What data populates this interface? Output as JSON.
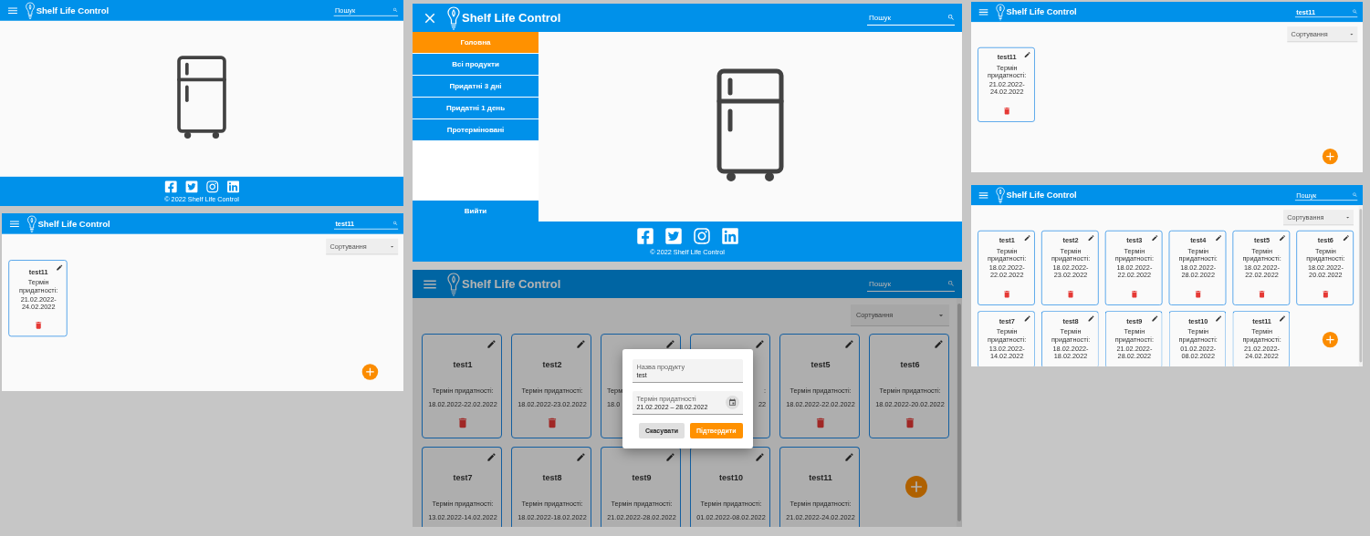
{
  "screens": [
    {
      "kind": "home",
      "header": {
        "menu_open": false,
        "title": "Shelf Life Control",
        "search": {
          "placeholder": "Пошук"
        }
      },
      "footer": {
        "copyright": "© 2022 Shelf Life Control"
      }
    },
    {
      "kind": "list",
      "header": {
        "menu_open": false,
        "title": "Shelf Life Control",
        "search": {
          "value": "test11"
        }
      },
      "sort": {
        "placeholder": "Сортування"
      },
      "scrollbar": false,
      "cards": [
        {
          "kind": "full",
          "title": "test11",
          "label": "Термін придатності:",
          "dates": "21.02.2022-24.02.2022"
        }
      ]
    },
    {
      "kind": "menu",
      "header": {
        "menu_open": true,
        "title": "Shelf Life Control",
        "search": {
          "placeholder": "Пошук"
        }
      },
      "sidebar": {
        "items": [
          {
            "label": "Головна",
            "selected": true
          },
          {
            "label": "Всі продукти",
            "selected": false
          },
          {
            "label": "Придатні 3 дні",
            "selected": false
          },
          {
            "label": "Придатні 1 день",
            "selected": false
          },
          {
            "label": "Протерміновані",
            "selected": false
          }
        ],
        "logout": "Вийти"
      },
      "footer": {
        "copyright": "© 2022 Shelf Life Control"
      }
    },
    {
      "kind": "list",
      "header": {
        "menu_open": false,
        "title": "Shelf Life Control",
        "search": {
          "placeholder": "Пошук"
        }
      },
      "sort": {
        "placeholder": "Сортування"
      },
      "scrollbar": true,
      "cards": [
        {
          "kind": "full",
          "title": "test1",
          "label": "Термін придатності:",
          "dates": "18.02.2022-22.02.2022"
        },
        {
          "kind": "full",
          "title": "test2",
          "label": "Термін придатності:",
          "dates": "18.02.2022-23.02.2022"
        },
        {
          "kind": "clip_left",
          "label": "Терм",
          "dates": "18.0"
        },
        {
          "kind": "clip_right",
          "label": ":",
          "dates": "22"
        },
        {
          "kind": "full",
          "title": "test5",
          "label": "Термін придатності:",
          "dates": "18.02.2022-22.02.2022"
        },
        {
          "kind": "full",
          "title": "test6",
          "label": "Термін придатності:",
          "dates": "18.02.2022-20.02.2022"
        },
        {
          "kind": "cut",
          "title": "test7",
          "label": "Термін придатності:",
          "dates": "13.02.2022-14.02.2022"
        },
        {
          "kind": "cut",
          "title": "test8",
          "label": "Термін придатності:",
          "dates": "18.02.2022-18.02.2022"
        },
        {
          "kind": "cut",
          "title": "test9",
          "label": "Термін придатності:",
          "dates": "21.02.2022-28.02.2022"
        },
        {
          "kind": "cut",
          "title": "test10",
          "label": "Термін придатності:",
          "dates": "01.02.2022-08.02.2022"
        },
        {
          "kind": "cut",
          "title": "test11",
          "label": "Термін придатності:",
          "dates": "21.02.2022-24.02.2022"
        }
      ],
      "dialog": {
        "fields": [
          {
            "kind": "text",
            "label": "Назва продукту",
            "value": "test"
          },
          {
            "kind": "date",
            "label": "Термін придатності",
            "value": "21.02.2022 – 28.02.2022"
          }
        ],
        "buttons": [
          {
            "kind": "secondary",
            "label": "Скасувати"
          },
          {
            "kind": "primary",
            "label": "Підтвердити"
          }
        ]
      }
    },
    {
      "kind": "list",
      "header": {
        "menu_open": false,
        "title": "Shelf Life Control",
        "search": {
          "value": "test11"
        }
      },
      "sort": {
        "placeholder": "Сортування"
      },
      "scrollbar": false,
      "cards": [
        {
          "kind": "full",
          "title": "test11",
          "label": "Термін придатності:",
          "dates": "21.02.2022-24.02.2022"
        }
      ]
    },
    {
      "kind": "list",
      "header": {
        "menu_open": false,
        "title": "Shelf Life Control",
        "search": {
          "placeholder": "Пошук"
        }
      },
      "sort": {
        "placeholder": "Сортування"
      },
      "scrollbar": true,
      "cards": [
        {
          "kind": "full",
          "title": "test1",
          "label": "Термін придатності:",
          "dates": "18.02.2022-22.02.2022"
        },
        {
          "kind": "full",
          "title": "test2",
          "label": "Термін придатності:",
          "dates": "18.02.2022-23.02.2022"
        },
        {
          "kind": "full",
          "title": "test3",
          "label": "Термін придатності:",
          "dates": "18.02.2022-22.02.2022"
        },
        {
          "kind": "full",
          "title": "test4",
          "label": "Термін придатності:",
          "dates": "18.02.2022-28.02.2022"
        },
        {
          "kind": "full",
          "title": "test5",
          "label": "Термін придатності:",
          "dates": "18.02.2022-22.02.2022"
        },
        {
          "kind": "full",
          "title": "test6",
          "label": "Термін придатності:",
          "dates": "18.02.2022-20.02.2022"
        },
        {
          "kind": "cut",
          "title": "test7",
          "label": "Термін придатності:",
          "dates": "13.02.2022-14.02.2022"
        },
        {
          "kind": "cut",
          "title": "test8",
          "label": "Термін придатності:",
          "dates": "18.02.2022-18.02.2022"
        },
        {
          "kind": "cut",
          "title": "test9",
          "label": "Термін придатності:",
          "dates": "21.02.2022-28.02.2022"
        },
        {
          "kind": "cut",
          "title": "test10",
          "label": "Термін придатності:",
          "dates": "01.02.2022-08.02.2022"
        },
        {
          "kind": "cut",
          "title": "test11",
          "label": "Термін придатності:",
          "dates": "21.02.2022-24.02.2022"
        }
      ]
    }
  ]
}
